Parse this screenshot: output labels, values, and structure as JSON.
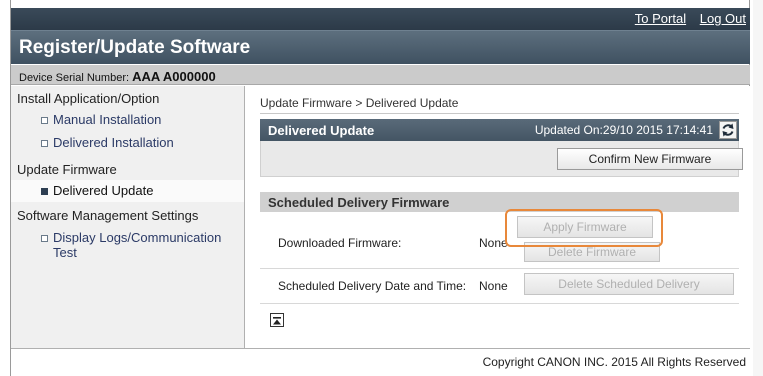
{
  "header": {
    "to_portal": "To Portal",
    "log_out": "Log Out",
    "title": "Register/Update Software"
  },
  "device": {
    "serial_label": "Device Serial Number:",
    "serial_value": "AAA A000000"
  },
  "sidebar": {
    "section_install": "Install Application/Option",
    "manual_installation": "Manual Installation",
    "delivered_installation": "Delivered Installation",
    "section_update": "Update Firmware",
    "delivered_update": "Delivered Update",
    "section_management": "Software Management Settings",
    "display_logs": "Display Logs/Communication Test"
  },
  "main": {
    "breadcrumb": "Update Firmware > Delivered Update",
    "delivered_update": {
      "title": "Delivered Update",
      "updated_on": "Updated On:29/10 2015 17:14:41",
      "confirm_button": "Confirm New Firmware"
    },
    "scheduled": {
      "title": "Scheduled Delivery Firmware",
      "downloaded_label": "Downloaded Firmware:",
      "downloaded_value": "None",
      "apply_button": "Apply Firmware",
      "delete_button": "Delete Firmware",
      "schedule_label": "Scheduled Delivery Date and Time:",
      "schedule_value": "None",
      "delete_schedule_button": "Delete Scheduled Delivery"
    }
  },
  "footer": {
    "copyright": "Copyright CANON INC. 2015 All Rights Reserved"
  },
  "icons": {
    "refresh": "refresh-icon",
    "page_top": "page-top-icon"
  },
  "colors": {
    "header_bar": "#2c3a48",
    "title_bar": "#4a5c6b",
    "highlight": "#e8883a",
    "active_bullet": "#2d3e52"
  }
}
